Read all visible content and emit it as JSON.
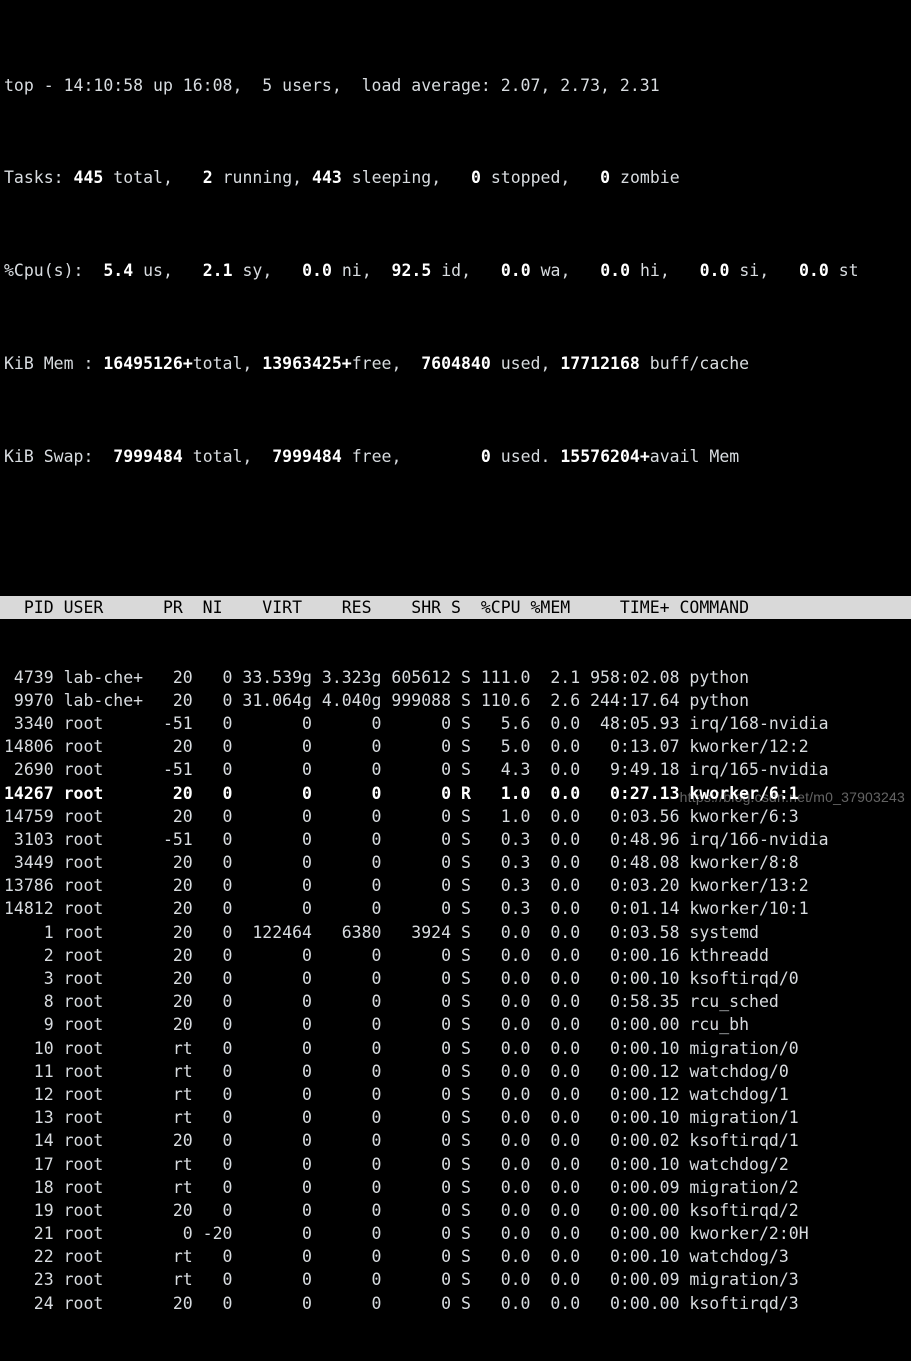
{
  "terminal": {
    "background_color": "#000000",
    "foreground_color": "#d8dce0",
    "header_bar_color": "#d9d9d9",
    "header_text_color": "#000000"
  },
  "summary": {
    "uptime_line": {
      "program": "top",
      "separator": "-",
      "time": "14:10:58",
      "up_label": "up",
      "uptime": "16:08,",
      "users_count": "5",
      "users_label": "users,",
      "load_label": "load average:",
      "load_1": "2.07,",
      "load_5": "2.73,",
      "load_15": "2.31",
      "full": "top - 14:10:58 up 16:08,  5 users,  load average: 2.07, 2.73, 2.31"
    },
    "tasks_line": {
      "label": "Tasks:",
      "total": "445",
      "total_label": "total,",
      "running": "2",
      "running_label": "running,",
      "sleeping": "443",
      "sleeping_label": "sleeping,",
      "stopped": "0",
      "stopped_label": "stopped,",
      "zombie": "0",
      "zombie_label": "zombie"
    },
    "cpu_line": {
      "label": "%Cpu(s):",
      "us": "5.4",
      "us_label": "us,",
      "sy": "2.1",
      "sy_label": "sy,",
      "ni": "0.0",
      "ni_label": "ni,",
      "id": "92.5",
      "id_label": "id,",
      "wa": "0.0",
      "wa_label": "wa,",
      "hi": "0.0",
      "hi_label": "hi,",
      "si": "0.0",
      "si_label": "si,",
      "st": "0.0",
      "st_label": "st"
    },
    "mem_line": {
      "label": "KiB Mem :",
      "total": "16495126+",
      "total_label": "total,",
      "free": "13963425+",
      "free_label": "free,",
      "used": "7604840",
      "used_label": "used,",
      "buff_cache": "17712168",
      "buff_cache_label": "buff/cache"
    },
    "swap_line": {
      "label": "KiB Swap:",
      "total": "7999484",
      "total_label": "total,",
      "free": "7999484",
      "free_label": "free,",
      "used": "0",
      "used_label": "used.",
      "avail": "15576204+",
      "avail_label": "avail Mem"
    }
  },
  "table": {
    "columns": [
      "PID",
      "USER",
      "PR",
      "NI",
      "VIRT",
      "RES",
      "SHR",
      "S",
      "%CPU",
      "%MEM",
      "TIME+",
      "COMMAND"
    ],
    "header_row": "  PID USER      PR  NI    VIRT    RES    SHR S  %CPU %MEM     TIME+ COMMAND",
    "rows": [
      {
        "pid": "4739",
        "user": "lab-che+",
        "pr": "20",
        "ni": "0",
        "virt": "33.539g",
        "res": "3.323g",
        "shr": "605612",
        "s": "S",
        "cpu": "111.0",
        "mem": "2.1",
        "time": "958:02.08",
        "command": "python",
        "bold": false
      },
      {
        "pid": "9970",
        "user": "lab-che+",
        "pr": "20",
        "ni": "0",
        "virt": "31.064g",
        "res": "4.040g",
        "shr": "999088",
        "s": "S",
        "cpu": "110.6",
        "mem": "2.6",
        "time": "244:17.64",
        "command": "python",
        "bold": false
      },
      {
        "pid": "3340",
        "user": "root",
        "pr": "-51",
        "ni": "0",
        "virt": "0",
        "res": "0",
        "shr": "0",
        "s": "S",
        "cpu": "5.6",
        "mem": "0.0",
        "time": "48:05.93",
        "command": "irq/168-nvidia",
        "bold": false
      },
      {
        "pid": "14806",
        "user": "root",
        "pr": "20",
        "ni": "0",
        "virt": "0",
        "res": "0",
        "shr": "0",
        "s": "S",
        "cpu": "5.0",
        "mem": "0.0",
        "time": "0:13.07",
        "command": "kworker/12:2",
        "bold": false
      },
      {
        "pid": "2690",
        "user": "root",
        "pr": "-51",
        "ni": "0",
        "virt": "0",
        "res": "0",
        "shr": "0",
        "s": "S",
        "cpu": "4.3",
        "mem": "0.0",
        "time": "9:49.18",
        "command": "irq/165-nvidia",
        "bold": false
      },
      {
        "pid": "14267",
        "user": "root",
        "pr": "20",
        "ni": "0",
        "virt": "0",
        "res": "0",
        "shr": "0",
        "s": "R",
        "cpu": "1.0",
        "mem": "0.0",
        "time": "0:27.13",
        "command": "kworker/6:1",
        "bold": true
      },
      {
        "pid": "14759",
        "user": "root",
        "pr": "20",
        "ni": "0",
        "virt": "0",
        "res": "0",
        "shr": "0",
        "s": "S",
        "cpu": "1.0",
        "mem": "0.0",
        "time": "0:03.56",
        "command": "kworker/6:3",
        "bold": false
      },
      {
        "pid": "3103",
        "user": "root",
        "pr": "-51",
        "ni": "0",
        "virt": "0",
        "res": "0",
        "shr": "0",
        "s": "S",
        "cpu": "0.3",
        "mem": "0.0",
        "time": "0:48.96",
        "command": "irq/166-nvidia",
        "bold": false
      },
      {
        "pid": "3449",
        "user": "root",
        "pr": "20",
        "ni": "0",
        "virt": "0",
        "res": "0",
        "shr": "0",
        "s": "S",
        "cpu": "0.3",
        "mem": "0.0",
        "time": "0:48.08",
        "command": "kworker/8:8",
        "bold": false
      },
      {
        "pid": "13786",
        "user": "root",
        "pr": "20",
        "ni": "0",
        "virt": "0",
        "res": "0",
        "shr": "0",
        "s": "S",
        "cpu": "0.3",
        "mem": "0.0",
        "time": "0:03.20",
        "command": "kworker/13:2",
        "bold": false
      },
      {
        "pid": "14812",
        "user": "root",
        "pr": "20",
        "ni": "0",
        "virt": "0",
        "res": "0",
        "shr": "0",
        "s": "S",
        "cpu": "0.3",
        "mem": "0.0",
        "time": "0:01.14",
        "command": "kworker/10:1",
        "bold": false
      },
      {
        "pid": "1",
        "user": "root",
        "pr": "20",
        "ni": "0",
        "virt": "122464",
        "res": "6380",
        "shr": "3924",
        "s": "S",
        "cpu": "0.0",
        "mem": "0.0",
        "time": "0:03.58",
        "command": "systemd",
        "bold": false
      },
      {
        "pid": "2",
        "user": "root",
        "pr": "20",
        "ni": "0",
        "virt": "0",
        "res": "0",
        "shr": "0",
        "s": "S",
        "cpu": "0.0",
        "mem": "0.0",
        "time": "0:00.16",
        "command": "kthreadd",
        "bold": false
      },
      {
        "pid": "3",
        "user": "root",
        "pr": "20",
        "ni": "0",
        "virt": "0",
        "res": "0",
        "shr": "0",
        "s": "S",
        "cpu": "0.0",
        "mem": "0.0",
        "time": "0:00.10",
        "command": "ksoftirqd/0",
        "bold": false
      },
      {
        "pid": "8",
        "user": "root",
        "pr": "20",
        "ni": "0",
        "virt": "0",
        "res": "0",
        "shr": "0",
        "s": "S",
        "cpu": "0.0",
        "mem": "0.0",
        "time": "0:58.35",
        "command": "rcu_sched",
        "bold": false
      },
      {
        "pid": "9",
        "user": "root",
        "pr": "20",
        "ni": "0",
        "virt": "0",
        "res": "0",
        "shr": "0",
        "s": "S",
        "cpu": "0.0",
        "mem": "0.0",
        "time": "0:00.00",
        "command": "rcu_bh",
        "bold": false
      },
      {
        "pid": "10",
        "user": "root",
        "pr": "rt",
        "ni": "0",
        "virt": "0",
        "res": "0",
        "shr": "0",
        "s": "S",
        "cpu": "0.0",
        "mem": "0.0",
        "time": "0:00.10",
        "command": "migration/0",
        "bold": false
      },
      {
        "pid": "11",
        "user": "root",
        "pr": "rt",
        "ni": "0",
        "virt": "0",
        "res": "0",
        "shr": "0",
        "s": "S",
        "cpu": "0.0",
        "mem": "0.0",
        "time": "0:00.12",
        "command": "watchdog/0",
        "bold": false
      },
      {
        "pid": "12",
        "user": "root",
        "pr": "rt",
        "ni": "0",
        "virt": "0",
        "res": "0",
        "shr": "0",
        "s": "S",
        "cpu": "0.0",
        "mem": "0.0",
        "time": "0:00.12",
        "command": "watchdog/1",
        "bold": false
      },
      {
        "pid": "13",
        "user": "root",
        "pr": "rt",
        "ni": "0",
        "virt": "0",
        "res": "0",
        "shr": "0",
        "s": "S",
        "cpu": "0.0",
        "mem": "0.0",
        "time": "0:00.10",
        "command": "migration/1",
        "bold": false
      },
      {
        "pid": "14",
        "user": "root",
        "pr": "20",
        "ni": "0",
        "virt": "0",
        "res": "0",
        "shr": "0",
        "s": "S",
        "cpu": "0.0",
        "mem": "0.0",
        "time": "0:00.02",
        "command": "ksoftirqd/1",
        "bold": false
      },
      {
        "pid": "17",
        "user": "root",
        "pr": "rt",
        "ni": "0",
        "virt": "0",
        "res": "0",
        "shr": "0",
        "s": "S",
        "cpu": "0.0",
        "mem": "0.0",
        "time": "0:00.10",
        "command": "watchdog/2",
        "bold": false
      },
      {
        "pid": "18",
        "user": "root",
        "pr": "rt",
        "ni": "0",
        "virt": "0",
        "res": "0",
        "shr": "0",
        "s": "S",
        "cpu": "0.0",
        "mem": "0.0",
        "time": "0:00.09",
        "command": "migration/2",
        "bold": false
      },
      {
        "pid": "19",
        "user": "root",
        "pr": "20",
        "ni": "0",
        "virt": "0",
        "res": "0",
        "shr": "0",
        "s": "S",
        "cpu": "0.0",
        "mem": "0.0",
        "time": "0:00.00",
        "command": "ksoftirqd/2",
        "bold": false
      },
      {
        "pid": "21",
        "user": "root",
        "pr": "0",
        "ni": "-20",
        "virt": "0",
        "res": "0",
        "shr": "0",
        "s": "S",
        "cpu": "0.0",
        "mem": "0.0",
        "time": "0:00.00",
        "command": "kworker/2:0H",
        "bold": false
      },
      {
        "pid": "22",
        "user": "root",
        "pr": "rt",
        "ni": "0",
        "virt": "0",
        "res": "0",
        "shr": "0",
        "s": "S",
        "cpu": "0.0",
        "mem": "0.0",
        "time": "0:00.10",
        "command": "watchdog/3",
        "bold": false
      },
      {
        "pid": "23",
        "user": "root",
        "pr": "rt",
        "ni": "0",
        "virt": "0",
        "res": "0",
        "shr": "0",
        "s": "S",
        "cpu": "0.0",
        "mem": "0.0",
        "time": "0:00.09",
        "command": "migration/3",
        "bold": false
      },
      {
        "pid": "24",
        "user": "root",
        "pr": "20",
        "ni": "0",
        "virt": "0",
        "res": "0",
        "shr": "0",
        "s": "S",
        "cpu": "0.0",
        "mem": "0.0",
        "time": "0:00.00",
        "command": "ksoftirqd/3",
        "bold": false
      }
    ]
  },
  "watermark": {
    "text": "https://blog.csdn.net/m0_37903243"
  }
}
